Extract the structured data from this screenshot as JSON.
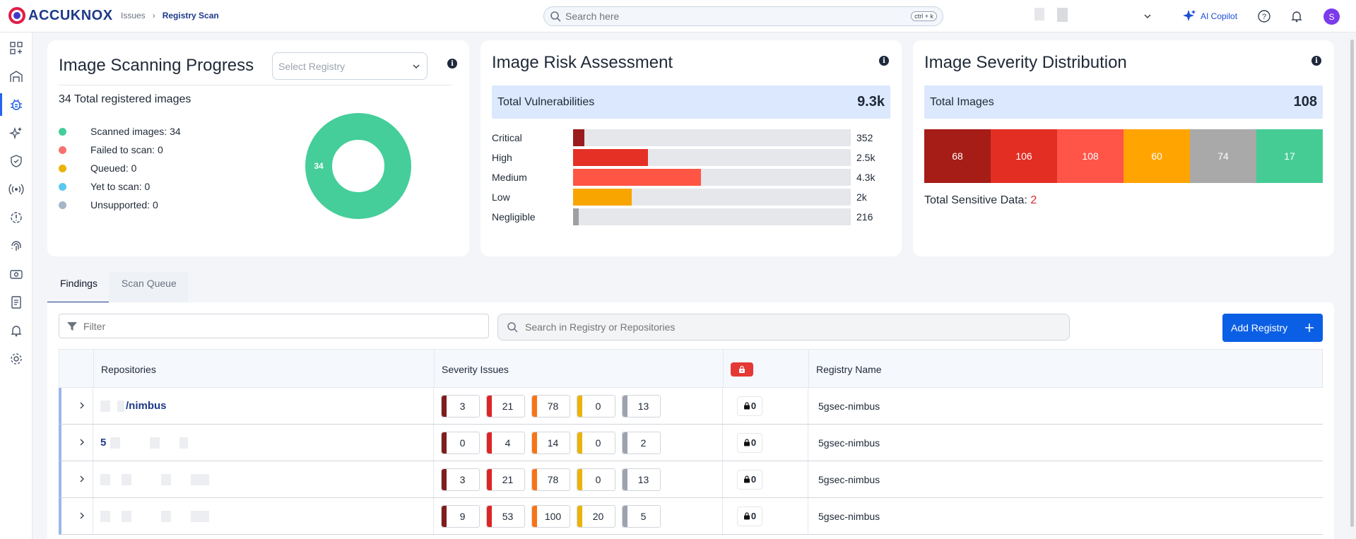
{
  "brand": {
    "name": "ACCUKNOX"
  },
  "breadcrumb": {
    "parent": "Issues",
    "current": "Registry Scan"
  },
  "search": {
    "placeholder": "Search here",
    "shortcut": "ctrl + k"
  },
  "header": {
    "copilot_label": "AI Copilot",
    "avatar_initial": "S"
  },
  "sidebar": {
    "items": [
      {
        "icon": "dashboard-icon"
      },
      {
        "icon": "inventory-icon"
      },
      {
        "icon": "issues-bug-icon",
        "active": true
      },
      {
        "icon": "ai-sparkle-icon"
      },
      {
        "icon": "shield-check-icon"
      },
      {
        "icon": "broadcast-icon"
      },
      {
        "icon": "settings-gear-icon"
      },
      {
        "icon": "fingerprint-icon"
      },
      {
        "icon": "ticket-icon"
      },
      {
        "icon": "report-icon"
      },
      {
        "icon": "bell-icon"
      },
      {
        "icon": "cog-icon"
      }
    ]
  },
  "scanning_progress": {
    "title": "Image Scanning Progress",
    "select_placeholder": "Select Registry",
    "total_text": "34 Total registered images",
    "legend": [
      {
        "label": "Scanned images: 34",
        "color": "#45ce99"
      },
      {
        "label": "Failed to scan: 0",
        "color": "#f87171"
      },
      {
        "label": "Queued: 0",
        "color": "#eab308"
      },
      {
        "label": "Yet to scan: 0",
        "color": "#5ac8f0"
      },
      {
        "label": "Unsupported: 0",
        "color": "#a5b4c6"
      }
    ],
    "donut_label": "34",
    "donut_color": "#45ce99"
  },
  "risk_assessment": {
    "title": "Image Risk Assessment",
    "total_label": "Total Vulnerabilities",
    "total_value": "9.3k",
    "rows": [
      {
        "label": "Critical",
        "value": "352",
        "fraction": 0.04,
        "color": "#9b1c1c"
      },
      {
        "label": "High",
        "value": "2.5k",
        "fraction": 0.27,
        "color": "#e53026"
      },
      {
        "label": "Medium",
        "value": "4.3k",
        "fraction": 0.46,
        "color": "#ff5545"
      },
      {
        "label": "Low",
        "value": "2k",
        "fraction": 0.21,
        "color": "#f8a500"
      },
      {
        "label": "Negligible",
        "value": "216",
        "fraction": 0.02,
        "color": "#a0a0a0"
      }
    ]
  },
  "severity_distribution": {
    "title": "Image Severity Distribution",
    "total_label": "Total Images",
    "total_value": "108",
    "segments": [
      {
        "value": "68",
        "color": "#a61c17"
      },
      {
        "value": "106",
        "color": "#e32e24"
      },
      {
        "value": "108",
        "color": "#ff5448"
      },
      {
        "value": "60",
        "color": "#ffa400"
      },
      {
        "value": "74",
        "color": "#a9a9a9"
      },
      {
        "value": "17",
        "color": "#45cc95"
      }
    ],
    "sensitive_label": "Total Sensitive Data:",
    "sensitive_value": "2"
  },
  "tabs": [
    {
      "label": "Findings",
      "active": true
    },
    {
      "label": "Scan Queue",
      "active": false
    }
  ],
  "findings": {
    "filter_placeholder": "Filter",
    "search_placeholder": "Search in Registry or Repositories",
    "add_button": "Add Registry",
    "columns": {
      "repositories": "Repositories",
      "severity": "Severity Issues",
      "registry": "Registry Name"
    },
    "rows": [
      {
        "repo_visible": "/nimbus",
        "severity": [
          "3",
          "21",
          "78",
          "0",
          "13"
        ],
        "secrets": "0",
        "registry": "5gsec-nimbus"
      },
      {
        "repo_visible": "5",
        "severity": [
          "0",
          "4",
          "14",
          "0",
          "2"
        ],
        "secrets": "0",
        "registry": "5gsec-nimbus"
      },
      {
        "repo_visible": "",
        "severity": [
          "3",
          "21",
          "78",
          "0",
          "13"
        ],
        "secrets": "0",
        "registry": "5gsec-nimbus"
      },
      {
        "repo_visible": "",
        "severity": [
          "9",
          "53",
          "100",
          "20",
          "5"
        ],
        "secrets": "0",
        "registry": "5gsec-nimbus"
      }
    ]
  }
}
